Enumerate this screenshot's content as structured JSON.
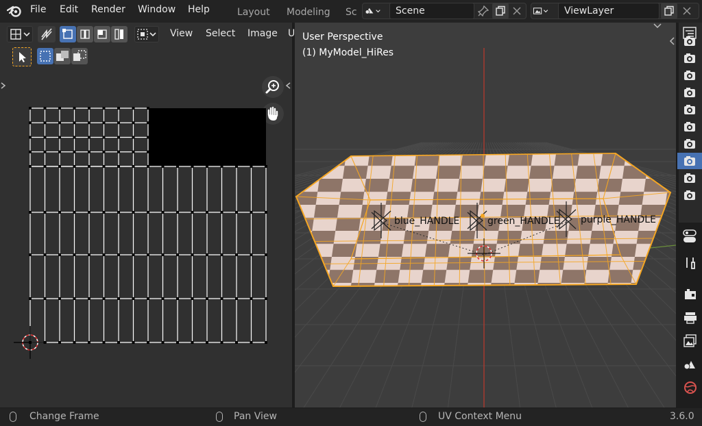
{
  "menu": {
    "file": "File",
    "edit": "Edit",
    "render": "Render",
    "window": "Window",
    "help": "Help"
  },
  "workspaces": {
    "layout": "Layout",
    "modeling": "Modeling",
    "truncated": "Sc"
  },
  "scene": {
    "name": "Scene"
  },
  "view_layer": {
    "name": "ViewLayer"
  },
  "uv_editor": {
    "menu": {
      "view": "View",
      "select": "Select",
      "image": "Image",
      "truncated": "U"
    }
  },
  "viewport": {
    "perspective": "User Perspective",
    "object_info": "(1) MyModel_HiRes",
    "objects": [
      {
        "label": "blue_HANDLE"
      },
      {
        "label": "green_HANDLE"
      },
      {
        "label": "purple_HANDLE"
      }
    ]
  },
  "status": {
    "left": "Change Frame",
    "middle": "Pan View",
    "right": "UV Context Menu",
    "version": "3.6.0"
  },
  "colors": {
    "accent_blue": "#4772b3",
    "selection_orange": "#f5a623",
    "checker_light": "#e8d4cc",
    "checker_dark": "#8e7568"
  }
}
